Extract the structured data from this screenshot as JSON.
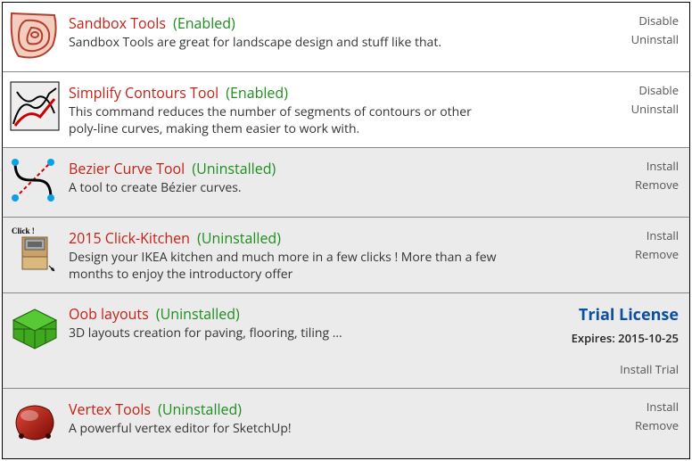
{
  "extensions": [
    {
      "name": "Sandbox Tools",
      "status": "(Enabled)",
      "desc": "Sandbox Tools are great for landscape design and stuff like that.",
      "actions": [
        "Disable",
        "Uninstall"
      ]
    },
    {
      "name": "Simplify Contours Tool",
      "status": "(Enabled)",
      "desc": "This command reduces the number of segments of contours or other poly-line curves, making them easier to work with.",
      "actions": [
        "Disable",
        "Uninstall"
      ]
    },
    {
      "name": "Bezier Curve Tool",
      "status": "(Uninstalled)",
      "desc": "A tool to create Bézier curves.",
      "actions": [
        "Install",
        "Remove"
      ]
    },
    {
      "name": "2015 Click-Kitchen",
      "status": "(Uninstalled)",
      "desc": "Design your IKEA kitchen and much more in a few clicks ! More than a few months to enjoy the introductory offer",
      "actions": [
        "Install",
        "Remove"
      ]
    },
    {
      "name": "Oob layouts",
      "status": "(Uninstalled)",
      "desc": "3D layouts creation for paving, flooring, tiling ...",
      "trial": {
        "title": "Trial License",
        "expires": "Expires: 2015-10-25"
      },
      "actions": [
        "Install Trial"
      ]
    },
    {
      "name": "Vertex Tools",
      "status": "(Uninstalled)",
      "desc": "A powerful vertex editor for SketchUp!",
      "actions": [
        "Install",
        "Remove"
      ]
    }
  ]
}
